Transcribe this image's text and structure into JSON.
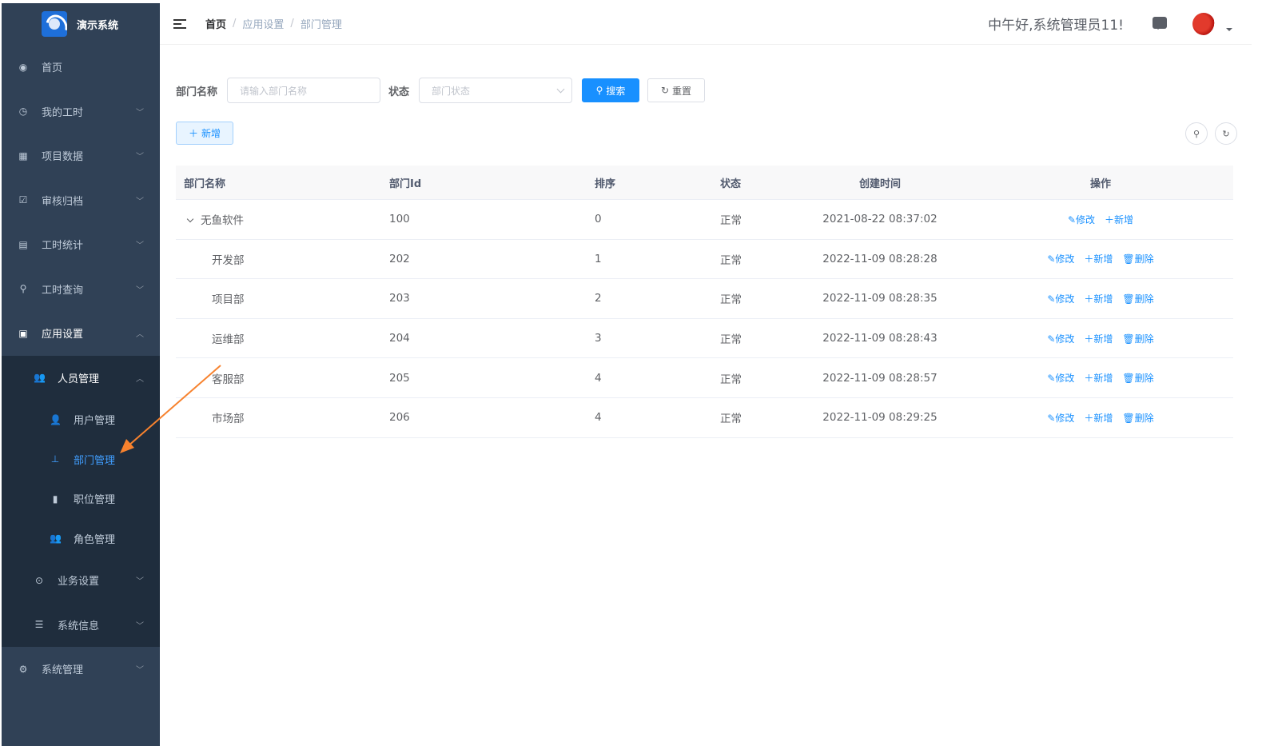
{
  "app": {
    "title": "演示系统"
  },
  "sidebar": {
    "items": [
      {
        "label": "首页",
        "icon": "dashboard-icon"
      },
      {
        "label": "我的工时",
        "icon": "clock-icon"
      },
      {
        "label": "项目数据",
        "icon": "table-icon"
      },
      {
        "label": "审核归档",
        "icon": "checkbox-icon"
      },
      {
        "label": "工时统计",
        "icon": "chart-icon"
      },
      {
        "label": "工时查询",
        "icon": "search-icon"
      },
      {
        "label": "应用设置",
        "icon": "form-icon"
      },
      {
        "label": "人员管理",
        "icon": "peoples-icon"
      },
      {
        "label": "用户管理",
        "icon": "user-icon"
      },
      {
        "label": "部门管理",
        "icon": "tree-icon"
      },
      {
        "label": "职位管理",
        "icon": "post-icon"
      },
      {
        "label": "角色管理",
        "icon": "role-icon"
      },
      {
        "label": "业务设置",
        "icon": "circle-check-icon"
      },
      {
        "label": "系统信息",
        "icon": "list-icon"
      },
      {
        "label": "系统管理",
        "icon": "gear-icon"
      }
    ]
  },
  "header": {
    "breadcrumb": [
      "首页",
      "应用设置",
      "部门管理"
    ],
    "greeting": "中午好,系统管理员11!"
  },
  "search": {
    "dept_label": "部门名称",
    "dept_placeholder": "请输入部门名称",
    "status_label": "状态",
    "status_placeholder": "部门状态",
    "search_btn": "搜索",
    "reset_btn": "重置",
    "add_btn": "新增"
  },
  "table": {
    "headers": [
      "部门名称",
      "部门Id",
      "排序",
      "状态",
      "创建时间",
      "操作"
    ],
    "ops": {
      "edit": "修改",
      "add": "新增",
      "delete": "删除"
    },
    "rows": [
      {
        "name": "无鱼软件",
        "id": "100",
        "sort": "0",
        "status": "正常",
        "time": "2021-08-22 08:37:02"
      },
      {
        "name": "开发部",
        "id": "202",
        "sort": "1",
        "status": "正常",
        "time": "2022-11-09 08:28:28"
      },
      {
        "name": "项目部",
        "id": "203",
        "sort": "2",
        "status": "正常",
        "time": "2022-11-09 08:28:35"
      },
      {
        "name": "运维部",
        "id": "204",
        "sort": "3",
        "status": "正常",
        "time": "2022-11-09 08:28:43"
      },
      {
        "name": "客服部",
        "id": "205",
        "sort": "4",
        "status": "正常",
        "time": "2022-11-09 08:28:57"
      },
      {
        "name": "市场部",
        "id": "206",
        "sort": "4",
        "status": "正常",
        "time": "2022-11-09 08:29:25"
      }
    ]
  },
  "colors": {
    "sidebar_bg": "#304156",
    "submenu_bg": "#1f2d3d",
    "accent": "#1890ff",
    "annotation": "#f7822e"
  }
}
